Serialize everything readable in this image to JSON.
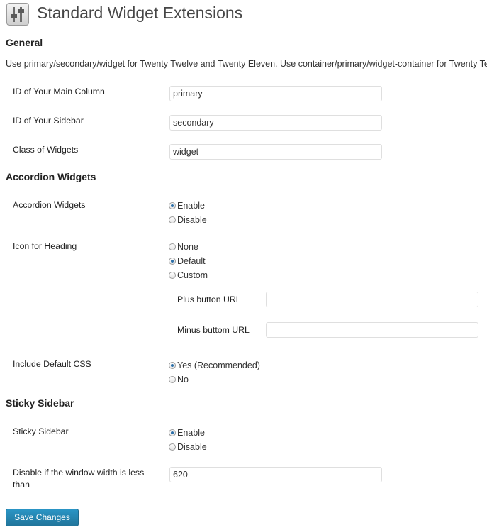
{
  "page": {
    "title": "Standard Widget Extensions",
    "icon": "settings-sliders-icon"
  },
  "general": {
    "heading": "General",
    "description": "Use primary/secondary/widget for Twenty Twelve and Twenty Eleven. Use container/primary/widget-container for Twenty Ten.",
    "main_column": {
      "label": "ID of Your Main Column",
      "value": "primary"
    },
    "sidebar": {
      "label": "ID of Your Sidebar",
      "value": "secondary"
    },
    "widgets": {
      "label": "Class of Widgets",
      "value": "widget"
    }
  },
  "accordion": {
    "heading": "Accordion Widgets",
    "toggle": {
      "label": "Accordion Widgets",
      "options": [
        "Enable",
        "Disable"
      ],
      "selected": "Enable"
    },
    "icon_heading": {
      "label": "Icon for Heading",
      "options": [
        "None",
        "Default",
        "Custom"
      ],
      "selected": "Default"
    },
    "plus_url": {
      "label": "Plus button URL",
      "value": ""
    },
    "minus_url": {
      "label": "Minus buttom URL",
      "value": ""
    },
    "default_css": {
      "label": "Include Default CSS",
      "options": [
        "Yes (Recommended)",
        "No"
      ],
      "selected": "Yes (Recommended)"
    }
  },
  "sticky": {
    "heading": "Sticky Sidebar",
    "toggle": {
      "label": "Sticky Sidebar",
      "options": [
        "Enable",
        "Disable"
      ],
      "selected": "Enable"
    },
    "width": {
      "label": "Disable if the window width is less than",
      "value": "620"
    }
  },
  "actions": {
    "save_label": "Save Changes"
  },
  "colors": {
    "accent": "#21759b",
    "radio_dot": "#2b6fa8",
    "input_border": "#dfdfdf"
  }
}
